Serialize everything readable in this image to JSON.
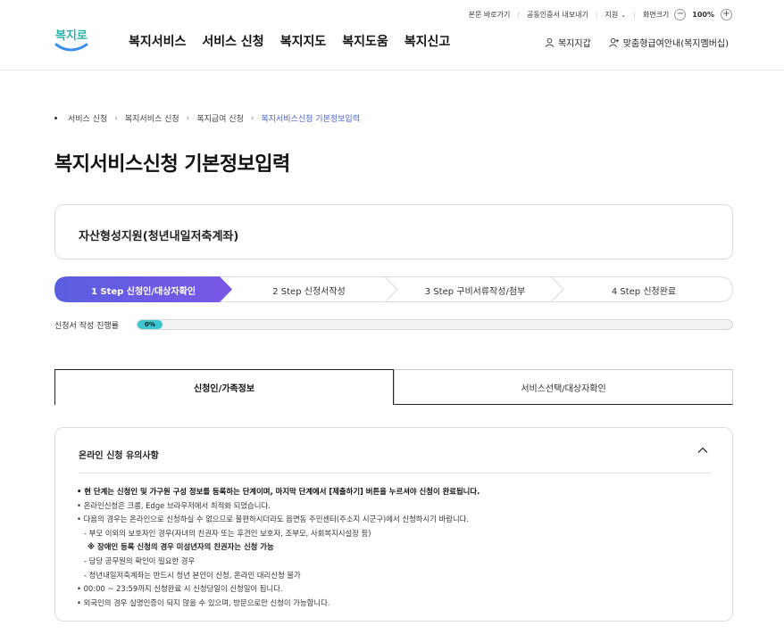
{
  "util": {
    "skip": "본문 바로가기",
    "cert": "공동인증서 내보내기",
    "lang": "지원",
    "zoom_label": "화면크기",
    "zoom_minus": "−",
    "zoom_value": "100%",
    "zoom_plus": "+"
  },
  "logo": {
    "text": "복지로"
  },
  "gnb": [
    "복지서비스",
    "서비스 신청",
    "복지지도",
    "복지도움",
    "복지신고"
  ],
  "header_right": {
    "wallet": "복지지갑",
    "guide": "맞춤형급여안내(복지멤버십)"
  },
  "breadcrumb": [
    "서비스 신청",
    "복지서비스 신청",
    "복지급여 신청",
    "복지서비스신청 기본정보입력"
  ],
  "page_title": "복지서비스신청 기본정보입력",
  "service_name": "자산형성지원(청년내일저축계좌)",
  "steps": [
    {
      "label": "1 Step 신청인/대상자확인",
      "active": true
    },
    {
      "label": "2 Step 신청서작성",
      "active": false
    },
    {
      "label": "3 Step 구비서류작성/첨부",
      "active": false
    },
    {
      "label": "4 Step 신청완료",
      "active": false
    }
  ],
  "progress": {
    "label": "신청서 작성 진행률",
    "value_text": "0%",
    "value": 0
  },
  "tabs": [
    {
      "label": "신청인/가족정보",
      "active": true
    },
    {
      "label": "서비스선택/대상자확인",
      "active": false
    }
  ],
  "notice": {
    "title": "온라인 신청 유의사항",
    "items": [
      {
        "text": "• 현 단계는 신청인 및 가구원 구성 정보를 등록하는 단계이며, 마지막 단계에서 [제출하기] 버튼을 누르셔야 신청이 완료됩니다.",
        "style": "bold"
      },
      {
        "text": "• 온라인신청은 크롬, Edge 브라우저에서 최적화 되었습니다.",
        "style": "normal"
      },
      {
        "text": "• 다음의 경우는 온라인으로 신청하실 수 없으므로 불편하시더라도 읍면동 주민센터(주소지 시군구)에서 신청하시기 바랍니다.",
        "style": "normal"
      },
      {
        "text": "- 부모 이외의 보호자인 경우(자녀의 친권자 또는 후견인 보호자, 조부모, 사회복지시설장 등)",
        "style": "sub"
      },
      {
        "text": "※ 장애인 등록 신청의 경우 미성년자의 친권자는 신청 가능",
        "style": "subsub"
      },
      {
        "text": "- 담당 공무원의 확인이 필요한 경우",
        "style": "sub"
      },
      {
        "text": "- 청년내일저축계좌는 반드시 청년 본인이 신청, 온라인 대리신청 불가",
        "style": "sub"
      },
      {
        "text": "• 00:00 ~ 23:59까지 신청완료 시 신청당일이 신청일이 됩니다.",
        "style": "normal"
      },
      {
        "text": "• 외국인의 경우 실명인증이 되지 않을 수 있으며, 방문으로만 신청이 가능합니다.",
        "style": "normal"
      }
    ]
  },
  "colors": {
    "step_active_start": "#5a5fe0",
    "step_active_end": "#7b57e8",
    "progress_fill": "#3cc6d0",
    "logo": "#27b0a9",
    "breadcrumb_current": "#4a63d8"
  }
}
